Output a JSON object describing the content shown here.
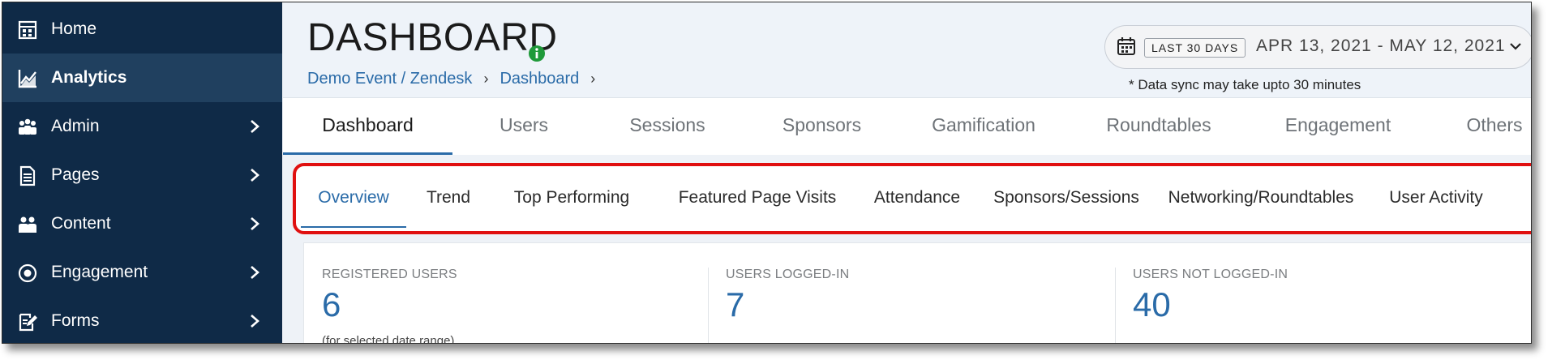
{
  "sidebar": {
    "items": [
      {
        "label": "Home",
        "icon": "home-grid-icon",
        "active": false,
        "chevron": false
      },
      {
        "label": "Analytics",
        "icon": "line-chart-icon",
        "active": true,
        "chevron": false
      },
      {
        "label": "Admin",
        "icon": "users-group-icon",
        "active": false,
        "chevron": true
      },
      {
        "label": "Pages",
        "icon": "document-icon",
        "active": false,
        "chevron": true
      },
      {
        "label": "Content",
        "icon": "people-icon",
        "active": false,
        "chevron": true
      },
      {
        "label": "Engagement",
        "icon": "target-icon",
        "active": false,
        "chevron": true
      },
      {
        "label": "Forms",
        "icon": "edit-form-icon",
        "active": false,
        "chevron": true
      }
    ]
  },
  "header": {
    "title": "DASHBOARD",
    "breadcrumb": [
      "Demo Event / Zendesk",
      "Dashboard"
    ],
    "date_range_badge": "LAST 30 DAYS",
    "date_range": "APR 13, 2021 - MAY 12, 2021",
    "sync_note": "* Data sync may take upto 30 minutes"
  },
  "tabs": [
    "Dashboard",
    "Users",
    "Sessions",
    "Sponsors",
    "Gamification",
    "Roundtables",
    "Engagement",
    "Others"
  ],
  "active_tab": "Dashboard",
  "subtabs": [
    "Overview",
    "Trend",
    "Top Performing",
    "Featured Page Visits",
    "Attendance",
    "Sponsors/Sessions",
    "Networking/Roundtables",
    "User Activity"
  ],
  "active_subtab": "Overview",
  "stats": [
    {
      "label": "REGISTERED USERS",
      "value": "6",
      "note": "(for selected date range)"
    },
    {
      "label": "USERS LOGGED-IN",
      "value": "7",
      "note": ""
    },
    {
      "label": "USERS NOT LOGGED-IN",
      "value": "40",
      "note": ""
    }
  ],
  "colors": {
    "sidebar_bg": "#0f2a47",
    "sidebar_active": "#20405f",
    "accent": "#2a6ba8",
    "highlight": "#e01010",
    "info_green": "#1f9a3a"
  }
}
